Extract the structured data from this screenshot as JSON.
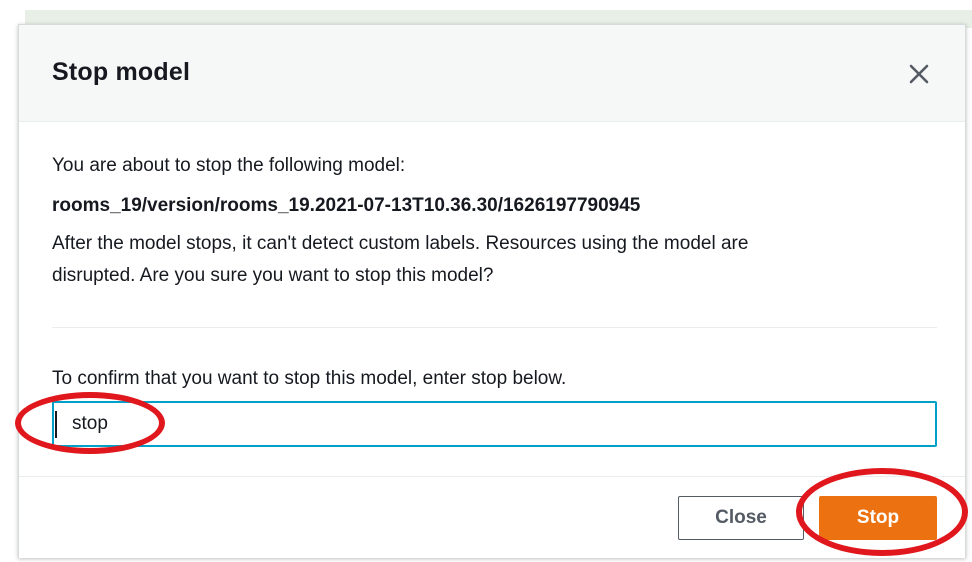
{
  "modal": {
    "title": "Stop model",
    "close_icon": "close-icon",
    "body": {
      "intro": "You are about to stop the following model:",
      "model_id": "rooms_19/version/rooms_19.2021-07-13T10.36.30/1626197790945",
      "warning_line1": "After the model stops, it can't detect custom labels. Resources using the model are",
      "warning_line2": "disrupted. Are you sure you want to stop this model?"
    },
    "confirm": {
      "label": "To confirm that you want to stop this model, enter stop below.",
      "value": "stop"
    },
    "footer": {
      "close_label": "Close",
      "stop_label": "Stop"
    }
  },
  "colors": {
    "primary_button": "#ec7211",
    "input_focus": "#00a1c9",
    "annotation": "#e0171c"
  }
}
